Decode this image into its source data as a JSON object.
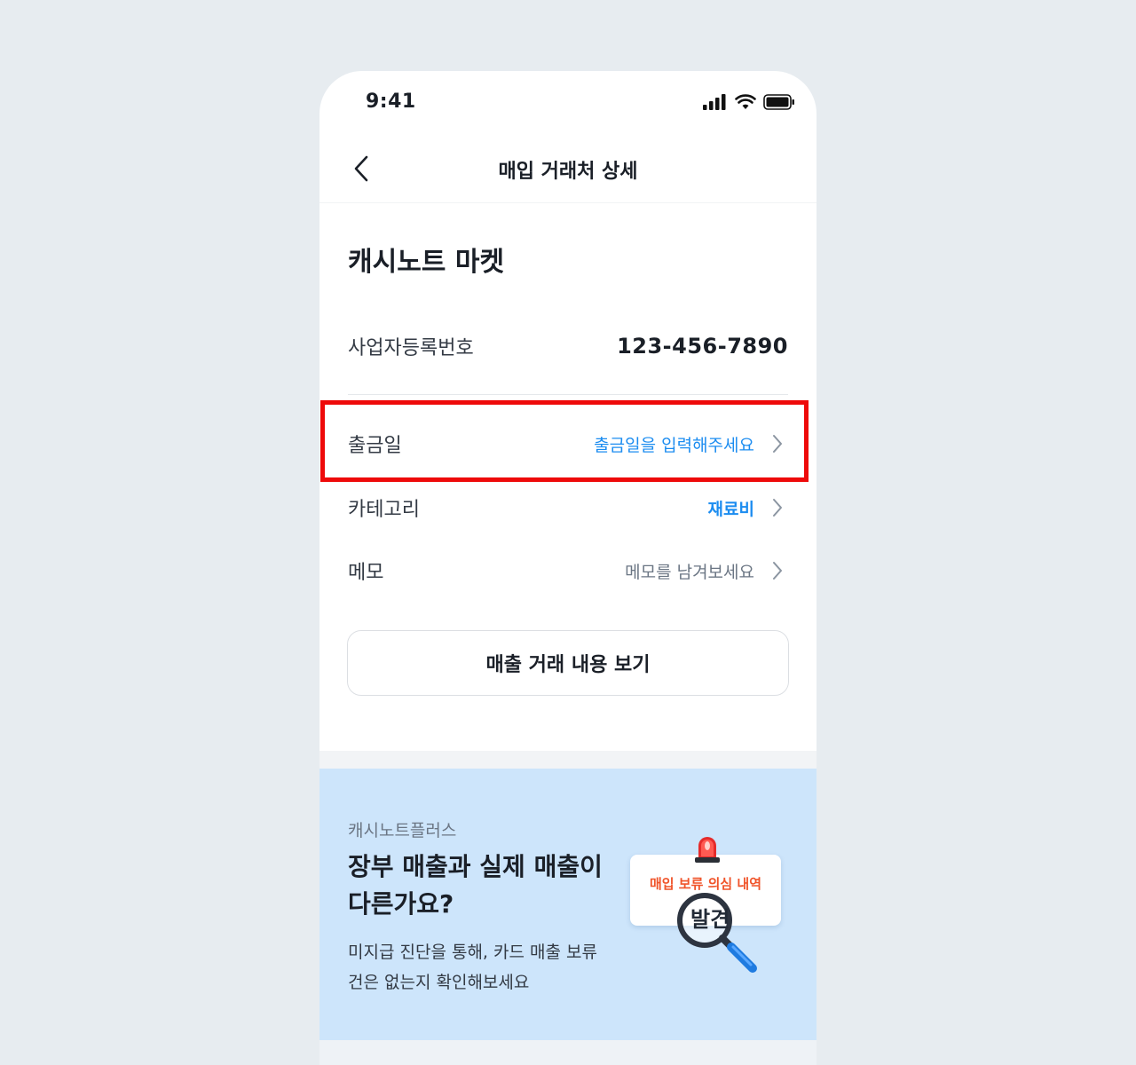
{
  "status_bar": {
    "time": "9:41"
  },
  "header": {
    "title": "매입 거래처 상세"
  },
  "merchant": {
    "name": "캐시노트 마켓"
  },
  "details": {
    "business_number": {
      "label": "사업자등록번호",
      "value": "123-456-7890"
    },
    "payment_date": {
      "label": "출금일",
      "placeholder": "출금일을 입력해주세요"
    },
    "category": {
      "label": "카테고리",
      "value": "재료비"
    },
    "memo": {
      "label": "메모",
      "placeholder": "메모를 남겨보세요"
    }
  },
  "sales_button": {
    "label": "매출 거래 내용 보기"
  },
  "banner": {
    "eyebrow": "캐시노트플러스",
    "headline": "장부 매출과 실제 매출이 다른가요?",
    "description": "미지급 진단을 통해, 카드 매출 보류 건은 없는지 확인해보세요",
    "illustration": {
      "alert_text": "매입 보류 의심 내역",
      "found_text": "발견"
    }
  },
  "colors": {
    "accent_blue": "#1b8cf0",
    "highlight_red": "#ee0a0a",
    "banner_bg": "#cde5fb",
    "alert_orange": "#f0542a"
  }
}
